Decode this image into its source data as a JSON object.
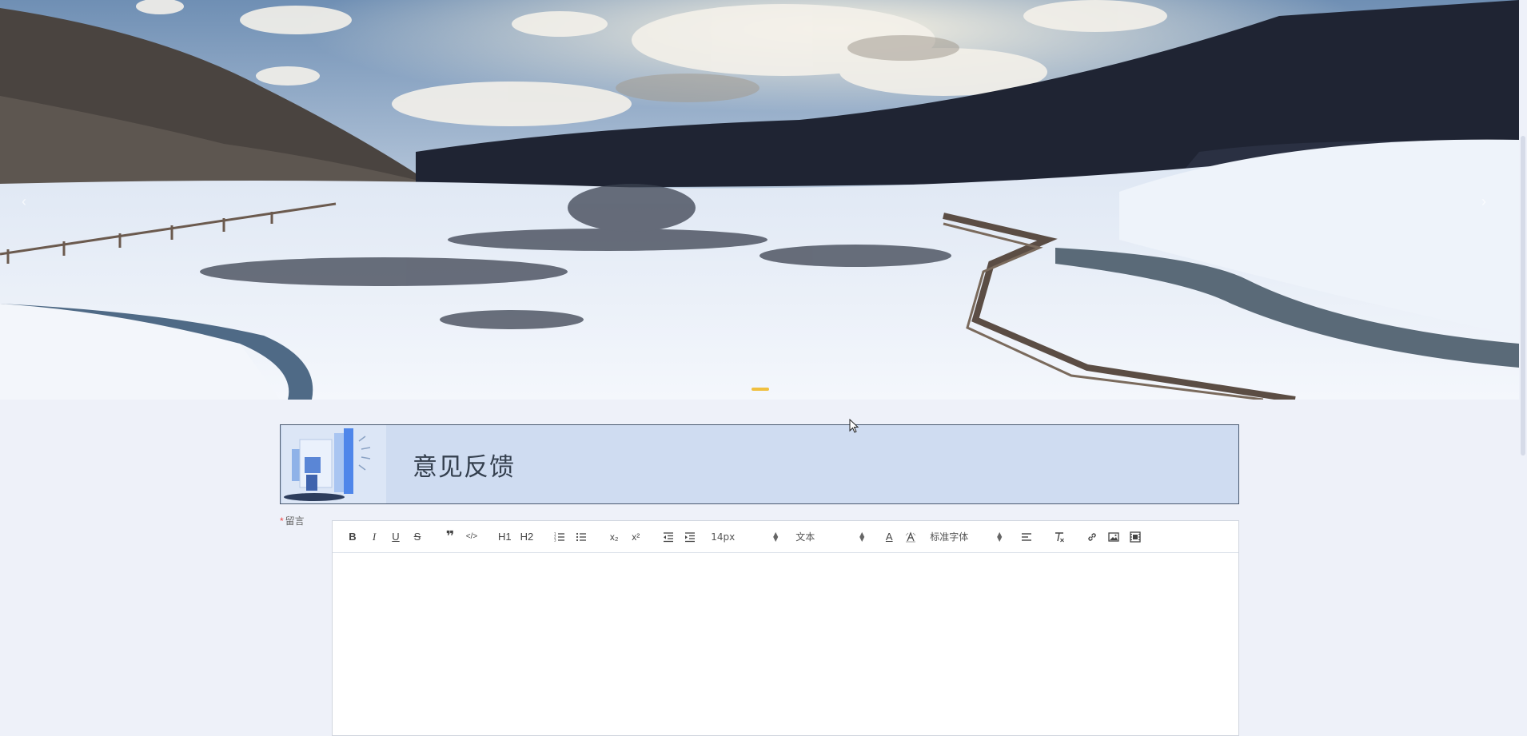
{
  "banner": {
    "image_icon": "snowy-valley-landscape",
    "prev_icon": "chevron-left-icon",
    "next_icon": "chevron-right-icon",
    "prev_glyph": "‹",
    "next_glyph": "›",
    "dot_count": 3,
    "active_dot": 1,
    "accent_color": "#f0c040"
  },
  "feedback": {
    "title": "意见反馈",
    "illustration_icon": "feedback-illustration-icon",
    "background_color": "#cfdcf1"
  },
  "form": {
    "message_label": "留言",
    "required_mark": "*",
    "editor": {
      "toolbar": {
        "bold": "B",
        "italic": "I",
        "underline": "U",
        "strike": "S",
        "blockquote": "❞",
        "code": "</>",
        "h1": "H1",
        "h2": "H2",
        "subscript": "x₂",
        "superscript": "x²",
        "size_value": "14px",
        "header_value": "文本",
        "font_value": "标准字体",
        "color_letter": "A"
      },
      "content": ""
    }
  }
}
